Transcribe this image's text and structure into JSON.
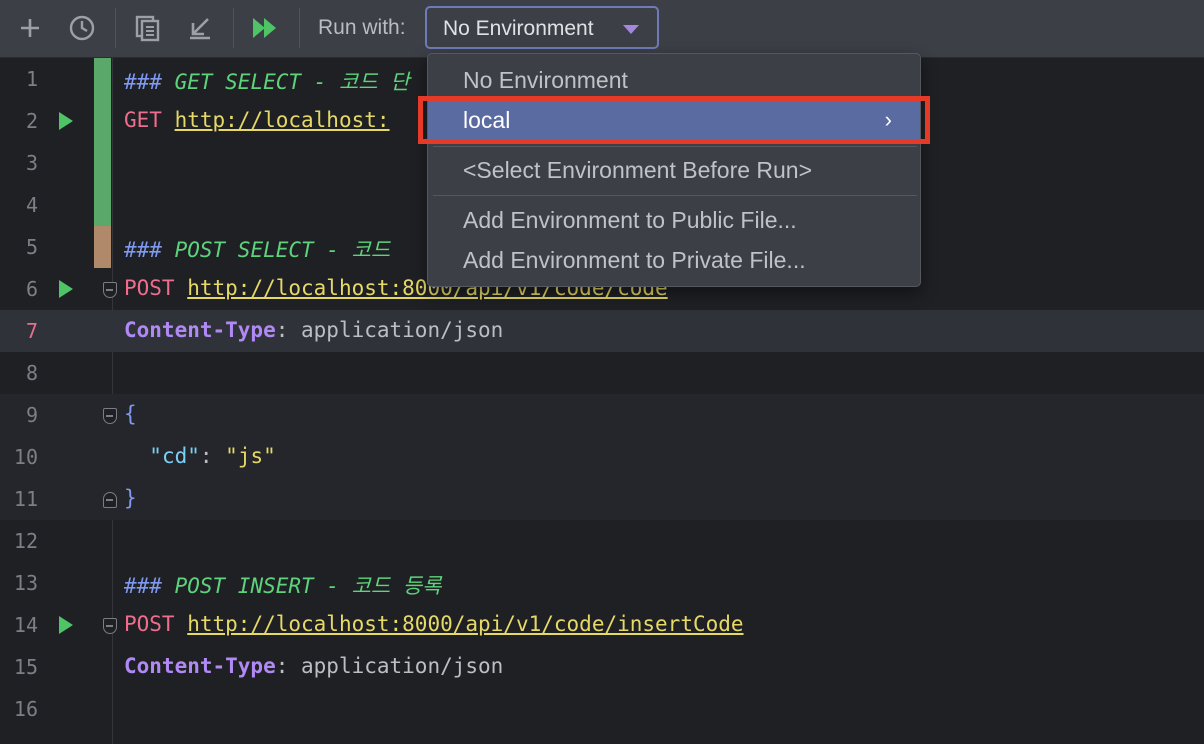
{
  "toolbar": {
    "icons": [
      "add-icon",
      "history-icon",
      "copy-icon",
      "import-icon",
      "run-all-icon"
    ],
    "run_with_label": "Run with:",
    "environment_value": "No Environment"
  },
  "editor": {
    "lines": [
      {
        "n": "1"
      },
      {
        "n": "2"
      },
      {
        "n": "3"
      },
      {
        "n": "4"
      },
      {
        "n": "5"
      },
      {
        "n": "6"
      },
      {
        "n": "7"
      },
      {
        "n": "8"
      },
      {
        "n": "9"
      },
      {
        "n": "10"
      },
      {
        "n": "11"
      },
      {
        "n": "12"
      },
      {
        "n": "13"
      },
      {
        "n": "14"
      },
      {
        "n": "15"
      },
      {
        "n": "16"
      }
    ],
    "code": {
      "l1_hash": "###",
      "l1_comment": " GET SELECT - 코드 단",
      "l2_method": "GET",
      "l2_url": "http://localhost:",
      "l5_hash": "###",
      "l5_comment": " POST SELECT - 코드",
      "l6_method": "POST",
      "l6_url": "http://localhost:8000/api/v1/code/code",
      "l7_key": "Content-Type",
      "l7_sep": ": ",
      "l7_value": "application/json",
      "l9_brace": "{",
      "l10_key": "\"cd\"",
      "l10_sep": ": ",
      "l10_value": "\"js\"",
      "l11_brace": "}",
      "l13_hash": "###",
      "l13_comment": " POST INSERT - 코드 등록",
      "l14_method": "POST",
      "l14_url": "http://localhost:8000/api/v1/code/insertCode",
      "l15_key": "Content-Type",
      "l15_sep": ": ",
      "l15_value": "application/json"
    }
  },
  "dropdown": {
    "items": [
      {
        "label": "No Environment"
      },
      {
        "label": "local",
        "chevron": "›"
      },
      {
        "label": "<Select Environment Before Run>"
      },
      {
        "label": "Add Environment to Public File..."
      },
      {
        "label": "Add Environment to Private File..."
      }
    ]
  },
  "colors": {
    "selection": "#5a6ba1",
    "highlight_box": "#e53a28",
    "run_green": "#4fc466"
  }
}
